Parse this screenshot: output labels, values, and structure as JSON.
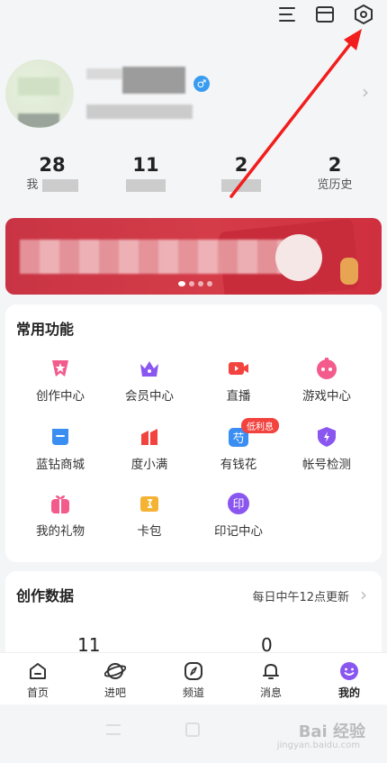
{
  "profile": {
    "gender_symbol": "♂"
  },
  "stats": [
    {
      "num": "28",
      "label": "我"
    },
    {
      "num": "11",
      "label": ""
    },
    {
      "num": "2",
      "label": ""
    },
    {
      "num": "2",
      "label": "览历史"
    }
  ],
  "common_functions": {
    "title": "常用功能",
    "items": [
      {
        "label": "创作中心",
        "icon": "star-flag-icon",
        "color": "#f25b8c"
      },
      {
        "label": "会员中心",
        "icon": "crown-icon",
        "color": "#8a56f0"
      },
      {
        "label": "直播",
        "icon": "video-camera-icon",
        "color": "#f2433f"
      },
      {
        "label": "游戏中心",
        "icon": "gamepad-icon",
        "color": "#f25b8c"
      },
      {
        "label": "蓝钻商城",
        "icon": "diamond-icon",
        "color": "#3a8ef2"
      },
      {
        "label": "度小满",
        "icon": "duxiaoman-icon",
        "color": "#f2433f"
      },
      {
        "label": "有钱花",
        "icon": "youqianhua-icon",
        "color": "#3a8ef2",
        "badge": "低利息"
      },
      {
        "label": "帐号检测",
        "icon": "shield-bolt-icon",
        "color": "#8a56f0"
      },
      {
        "label": "我的礼物",
        "icon": "gift-icon",
        "color": "#f25b8c"
      },
      {
        "label": "卡包",
        "icon": "card-wallet-icon",
        "color": "#f5b335"
      },
      {
        "label": "印记中心",
        "icon": "seal-icon",
        "color": "#8a56f0",
        "glyph": "印"
      }
    ]
  },
  "creation_data": {
    "title": "创作数据",
    "update_note": "每日中午12点更新",
    "values": [
      "11",
      "0"
    ]
  },
  "tabbar": [
    {
      "label": "首页",
      "icon": "home-icon"
    },
    {
      "label": "进吧",
      "icon": "planet-icon"
    },
    {
      "label": "频道",
      "icon": "compass-icon"
    },
    {
      "label": "消息",
      "icon": "bell-icon"
    },
    {
      "label": "我的",
      "icon": "smile-icon",
      "active": true
    }
  ],
  "watermark": {
    "text": "Bai 经验",
    "sub": "jingyan.baidu.com"
  }
}
